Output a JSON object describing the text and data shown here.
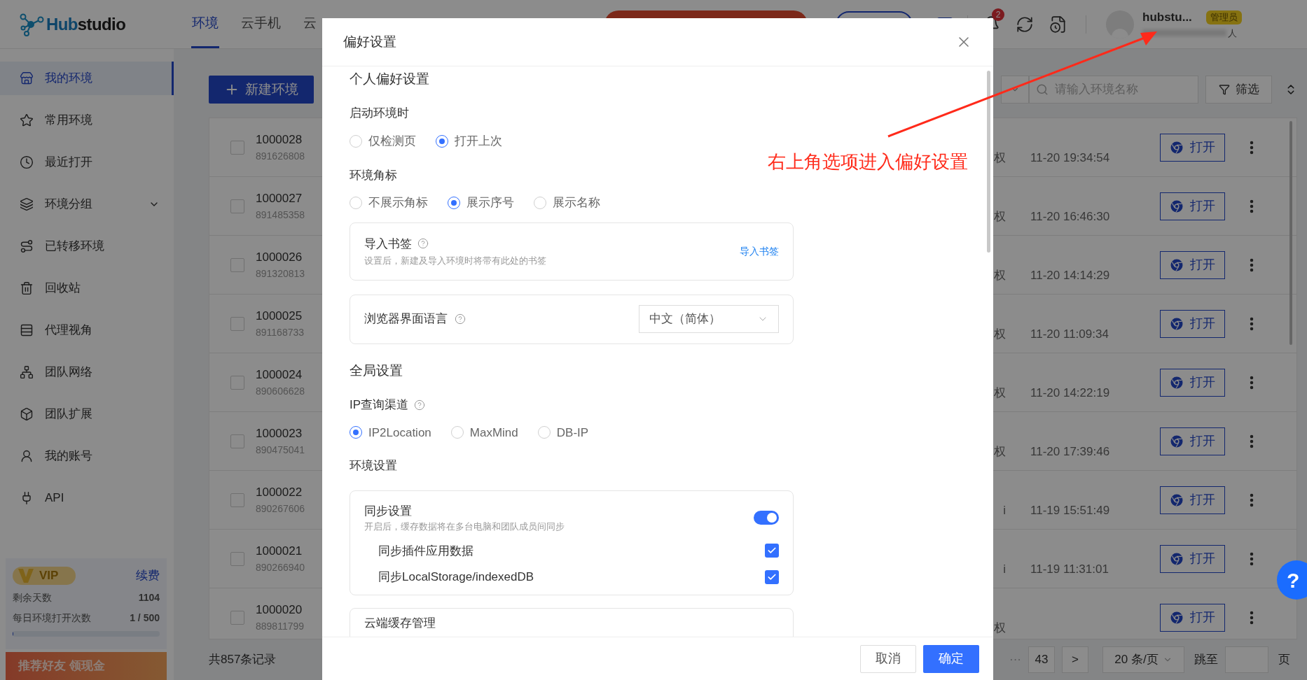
{
  "app": {
    "logo_accent": "Hub",
    "logo_rest": "studio",
    "nav_tabs": [
      {
        "label": "环境",
        "selected": true
      },
      {
        "label": "云手机",
        "selected": false
      },
      {
        "label": "云",
        "selected": false
      }
    ],
    "notifications_badge": "2",
    "user": {
      "name": "hubstu...",
      "role": "管理员",
      "team": "人"
    }
  },
  "sidebar": {
    "items": [
      {
        "label": "我的环境",
        "selected": true,
        "kind": "link"
      },
      {
        "label": "常用环境",
        "selected": false,
        "kind": "link"
      },
      {
        "label": "最近打开",
        "selected": false,
        "kind": "link"
      },
      {
        "label": "环境分组",
        "selected": false,
        "kind": "group"
      },
      {
        "label": "已转移环境",
        "selected": false,
        "kind": "link"
      },
      {
        "label": "回收站",
        "selected": false,
        "kind": "link"
      },
      {
        "label": "代理视角",
        "selected": false,
        "kind": "link"
      },
      {
        "label": "团队网络",
        "selected": false,
        "kind": "link"
      },
      {
        "label": "团队扩展",
        "selected": false,
        "kind": "link"
      },
      {
        "label": "我的账号",
        "selected": false,
        "kind": "link"
      },
      {
        "label": "API",
        "selected": false,
        "kind": "link"
      }
    ],
    "vip": {
      "badge": "VIP",
      "renew": "续费",
      "stats": [
        {
          "label": "剩余天数",
          "value": "1104"
        },
        {
          "label": "每日环境打开次数",
          "value": "1 / 500"
        }
      ],
      "level": 0.003
    },
    "promo": "推荐好友 领现金"
  },
  "main": {
    "new_button": "新建环境",
    "search": {
      "placeholder": "请输入环境名称"
    },
    "filter": "筛选",
    "rows": [
      {
        "name": "1000028",
        "serial": "891626808",
        "checked": false,
        "column_3": "权",
        "time": "11-20 19:34:54",
        "action": "打开"
      },
      {
        "name": "1000027",
        "serial": "891485358",
        "checked": false,
        "column_3": "权",
        "time": "11-20 16:46:30",
        "action": "打开"
      },
      {
        "name": "1000026",
        "serial": "891320813",
        "checked": false,
        "column_3": "权",
        "time": "11-20 14:14:29",
        "action": "打开"
      },
      {
        "name": "1000025",
        "serial": "891168733",
        "checked": false,
        "column_3": "权",
        "time": "11-20 11:09:34",
        "action": "打开"
      },
      {
        "name": "1000024",
        "serial": "890606628",
        "checked": false,
        "column_3": "权",
        "time": "11-20 14:22:19",
        "action": "打开"
      },
      {
        "name": "1000023",
        "serial": "890475041",
        "checked": false,
        "column_3": "权",
        "time": "11-20 17:39:46",
        "action": "打开"
      },
      {
        "name": "1000022",
        "serial": "890267606",
        "checked": false,
        "column_3": "i",
        "time": "11-19 15:51:49",
        "action": "打开"
      },
      {
        "name": "1000021",
        "serial": "890266940",
        "checked": false,
        "column_3": "i",
        "time": "11-19 11:31:01",
        "action": "打开"
      },
      {
        "name": "1000020",
        "serial": "889811799",
        "checked": false,
        "column_3": "权",
        "action": "打开"
      }
    ],
    "total": "共857条记录",
    "pagination": {
      "ellipsis": "···",
      "page": "43",
      "next": ">",
      "page_size": "20 条/页",
      "jump": "跳至",
      "page_unit": "页"
    }
  },
  "help": "?",
  "dialog": {
    "title": "偏好设置",
    "personal_title": "个人偏好设置",
    "startup": {
      "label": "启动环境时",
      "options": [
        {
          "label": "仅检测页",
          "selected": false
        },
        {
          "label": "打开上次",
          "selected": true
        }
      ]
    },
    "badge": {
      "label": "环境角标",
      "options": [
        {
          "label": "不展示角标",
          "selected": false
        },
        {
          "label": "展示序号",
          "selected": true
        },
        {
          "label": "展示名称",
          "selected": false
        }
      ]
    },
    "bookmarks": {
      "title": "导入书签",
      "description": "设置后，新建及导入环境时将带有此处的书签",
      "link": "导入书签"
    },
    "language": {
      "title": "浏览器界面语言",
      "value": "中文（简体）"
    },
    "global_title": "全局设置",
    "ip_channel": {
      "label": "IP查询渠道",
      "options": [
        {
          "label": "IP2Location",
          "selected": true
        },
        {
          "label": "MaxMind",
          "selected": false
        },
        {
          "label": "DB-IP",
          "selected": false
        }
      ]
    },
    "env_title": "环境设置",
    "sync": {
      "title": "同步设置",
      "description": "开启后，缓存数据将在多台电脑和团队成员间同步",
      "on": true,
      "items": [
        {
          "label": "同步插件应用数据",
          "checked": true
        },
        {
          "label": "同步LocalStorage/indexedDB",
          "checked": true
        }
      ]
    },
    "cloud_cache": {
      "title": "云端缓存管理"
    },
    "buttons": [
      {
        "label": "取消",
        "kind": "secondary"
      },
      {
        "label": "确定",
        "kind": "primary"
      }
    ]
  },
  "annotation": "右上角选项进入偏好设置"
}
